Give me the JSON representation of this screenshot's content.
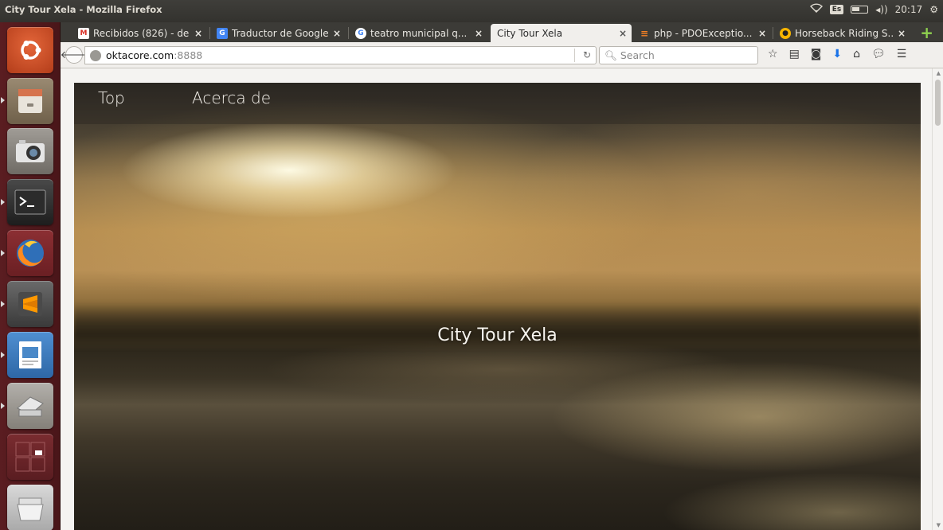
{
  "os_panel": {
    "window_title": "City Tour Xela - Mozilla Firefox",
    "keyboard_layout": "Es",
    "clock": "20:17",
    "icons": [
      "wifi-icon",
      "battery-icon",
      "volume-icon",
      "settings-gear-icon"
    ]
  },
  "launcher": {
    "items": [
      {
        "name": "ubuntu-dash",
        "icon": "ubuntu-logo-icon",
        "color": "#d8542a"
      },
      {
        "name": "files",
        "icon": "file-cabinet-icon",
        "color": "#8b7a62"
      },
      {
        "name": "camera",
        "icon": "camera-icon",
        "color": "#7d7d7d"
      },
      {
        "name": "terminal",
        "icon": "terminal-icon",
        "color": "#2c2c2c"
      },
      {
        "name": "firefox",
        "icon": "firefox-icon",
        "color": "#e66000"
      },
      {
        "name": "sublime-text",
        "icon": "sublime-text-icon",
        "color": "#f5a623"
      },
      {
        "name": "libreoffice-impress",
        "icon": "presentation-icon",
        "color": "#3b7bbf"
      },
      {
        "name": "scanner",
        "icon": "scanner-icon",
        "color": "#a0a0a0"
      },
      {
        "name": "workspaces",
        "icon": "workspace-switcher-icon",
        "color": "#6a2327"
      },
      {
        "name": "trash",
        "icon": "trash-icon",
        "color": "#c9c9c9"
      }
    ]
  },
  "browser": {
    "tabs": [
      {
        "label": "Recibidos (826) - de...",
        "favicon": "gmail-icon",
        "active": false
      },
      {
        "label": "Traductor de Google",
        "favicon": "google-translate-icon",
        "active": false
      },
      {
        "label": "teatro municipal q...",
        "favicon": "google-icon",
        "active": false
      },
      {
        "label": "City Tour Xela",
        "favicon": "",
        "active": true
      },
      {
        "label": "php - PDOExceptio...",
        "favicon": "stackoverflow-icon",
        "active": false
      },
      {
        "label": "Horseback Riding S...",
        "favicon": "tripadvisor-icon",
        "active": false
      }
    ],
    "url_host": "oktacore.com",
    "url_port": ":8888",
    "search_placeholder": "Search"
  },
  "page": {
    "nav_links": [
      "Top",
      "Acerca de"
    ],
    "hero_title": "City Tour Xela"
  }
}
